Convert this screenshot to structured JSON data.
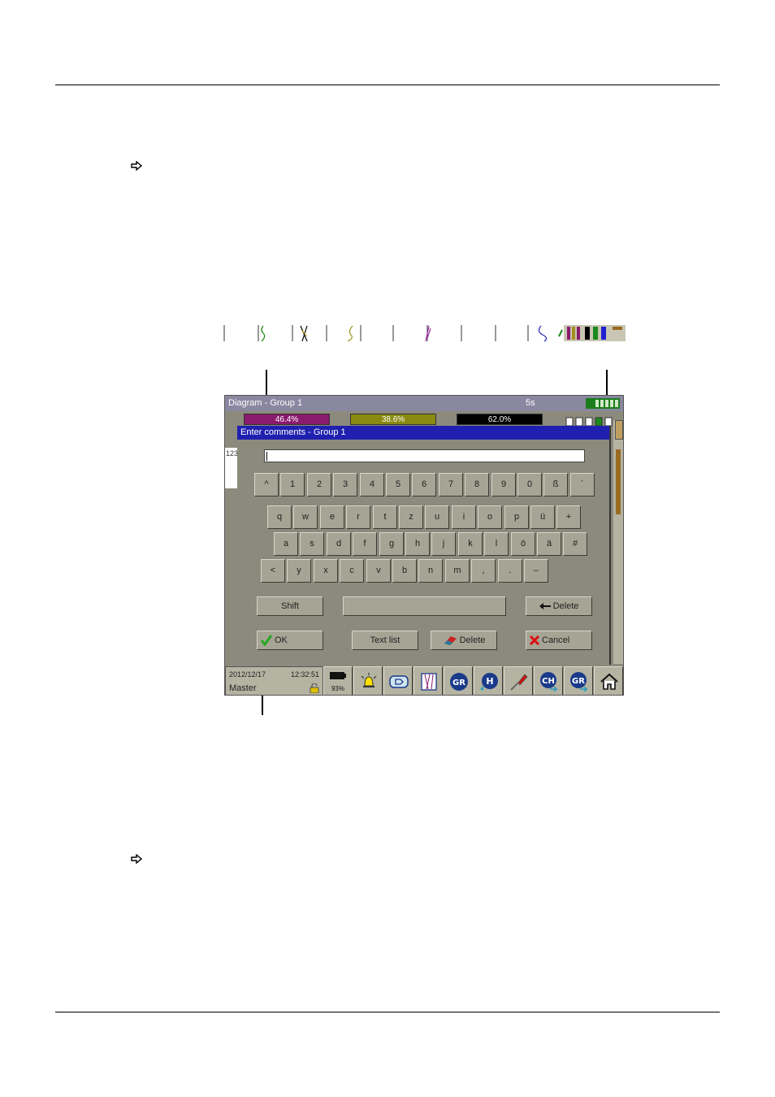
{
  "screen": {
    "title": "Diagram - Group 1",
    "interval": "5s",
    "channel_bars": [
      {
        "value": "46.4%",
        "color": "#8a1a6e"
      },
      {
        "value": "38.6%",
        "color": "#8a8a12"
      },
      {
        "value": "62.0%",
        "color": "#000000"
      }
    ],
    "chart_label": "123"
  },
  "dialog": {
    "title": "Enter comments - Group 1",
    "input_value": "",
    "rows": [
      [
        "^",
        "1",
        "2",
        "3",
        "4",
        "5",
        "6",
        "7",
        "8",
        "9",
        "0",
        "ß",
        "´"
      ],
      [
        "q",
        "w",
        "e",
        "r",
        "t",
        "z",
        "u",
        "i",
        "o",
        "p",
        "ü",
        "+"
      ],
      [
        "a",
        "s",
        "d",
        "f",
        "g",
        "h",
        "j",
        "k",
        "l",
        "ö",
        "ä",
        "#"
      ],
      [
        "<",
        "y",
        "x",
        "c",
        "v",
        "b",
        "n",
        "m",
        ",",
        ".",
        "–"
      ]
    ],
    "shift_label": "Shift",
    "space_label": "",
    "backspace_label": "Delete",
    "ok_label": "OK",
    "text_list_label": "Text list",
    "delete_label": "Delete",
    "cancel_label": "Cancel"
  },
  "status": {
    "date": "2012/12/17",
    "time": "12:32:51",
    "user": "Master",
    "memory": "93%"
  },
  "colors": {
    "titlebar": "#8a87a0",
    "dialog_title": "#2020b0",
    "ok_check": "#22aa22",
    "cancel_x": "#dd1111"
  }
}
